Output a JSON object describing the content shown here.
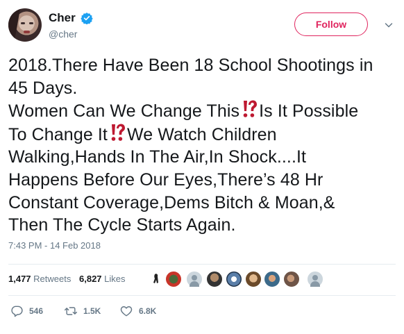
{
  "author": {
    "display_name": "Cher",
    "handle": "@cher",
    "verified_icon": "verified-badge-icon"
  },
  "header": {
    "follow_label": "Follow",
    "caret_icon": "chevron-down-icon"
  },
  "tweet": {
    "lines": [
      "2018.There Have Been 18 School Shootings in",
      "45 Days.",
      "Women Can We Change This",
      "Is It Possible",
      "To Change It",
      "We Watch Children",
      "Walking,Hands In The Air,In Shock....It",
      "Happens Before Our Eyes,There’s 48 Hr",
      "Constant Coverage,Dems Bitch & Moan,&",
      "Then The Cycle Starts Again."
    ],
    "emoji_icon": "interrobang-icon",
    "timestamp": "7:43 PM - 14 Feb 2018"
  },
  "stats": {
    "retweets_count": "1,477",
    "retweets_label": "Retweets",
    "likes_count": "6,827",
    "likes_label": "Likes"
  },
  "actions": {
    "reply_count": "546",
    "retweet_count": "1.5K",
    "like_count": "6.8K"
  },
  "colors": {
    "accent": "#e0245e",
    "verified": "#1da1f2",
    "muted": "#657786",
    "emoji": "#be1931"
  }
}
